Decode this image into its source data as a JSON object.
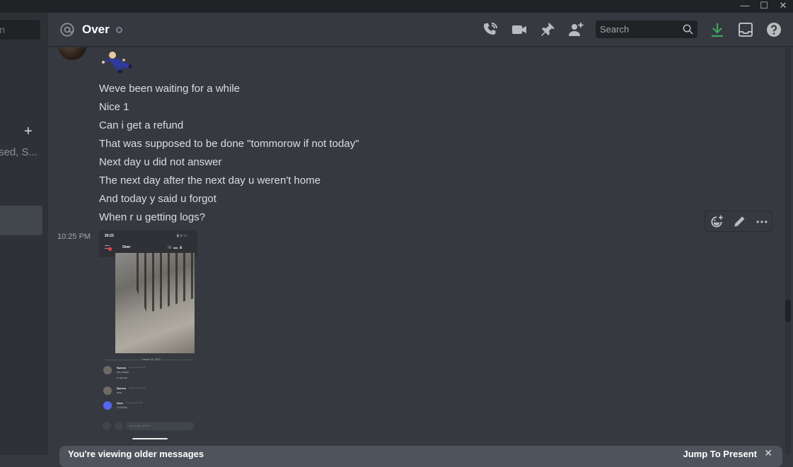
{
  "window": {
    "minimize_label": "—",
    "maximize_label": "☐",
    "close_label": "✕"
  },
  "sidebar": {
    "search_partial": "n",
    "add_dm_label": "+",
    "dm_status_partial": "sed, S..."
  },
  "header": {
    "channel_name": "Over",
    "search_placeholder": "Search",
    "icons": [
      "voice-call-icon",
      "video-call-icon",
      "pin-icon",
      "add-friend-icon",
      "search-icon",
      "download-icon",
      "inbox-icon",
      "help-icon"
    ],
    "download_color": "#3ba55d"
  },
  "messages": {
    "lines": [
      "Weve been waiting for a while",
      "Nice 1",
      "Can i get a refund",
      "That was supposed to be done \"tommorow if not today\"",
      "Next day u did not answer",
      "The next day after the next day u weren't home",
      "And today y said u forgot",
      "When r u getting logs?"
    ],
    "timestamp": "10:25 PM",
    "hover_actions": [
      "add-reaction-icon",
      "edit-icon",
      "more-icon"
    ]
  },
  "attachment": {
    "status_time": "20:23",
    "chat_name": "Over",
    "date_divider": "October 30, 2022",
    "chat": [
      {
        "author": "Survvz",
        "time": "Today at 3:52 PM",
        "lines": [
          "b4u when",
          "a ow ine"
        ]
      },
      {
        "author": "Survvz",
        "time": "Today at 6:00 PM",
        "lines": [
          "nice"
        ]
      },
      {
        "author": "Over",
        "time": "Today at 6:56 PM",
        "lines": [
          "I KNOW"
        ]
      }
    ],
    "message_placeholder": "Message @Over"
  },
  "banner": {
    "text": "You're viewing older messages",
    "jump_label": "Jump To Present",
    "close_label": "✕"
  }
}
